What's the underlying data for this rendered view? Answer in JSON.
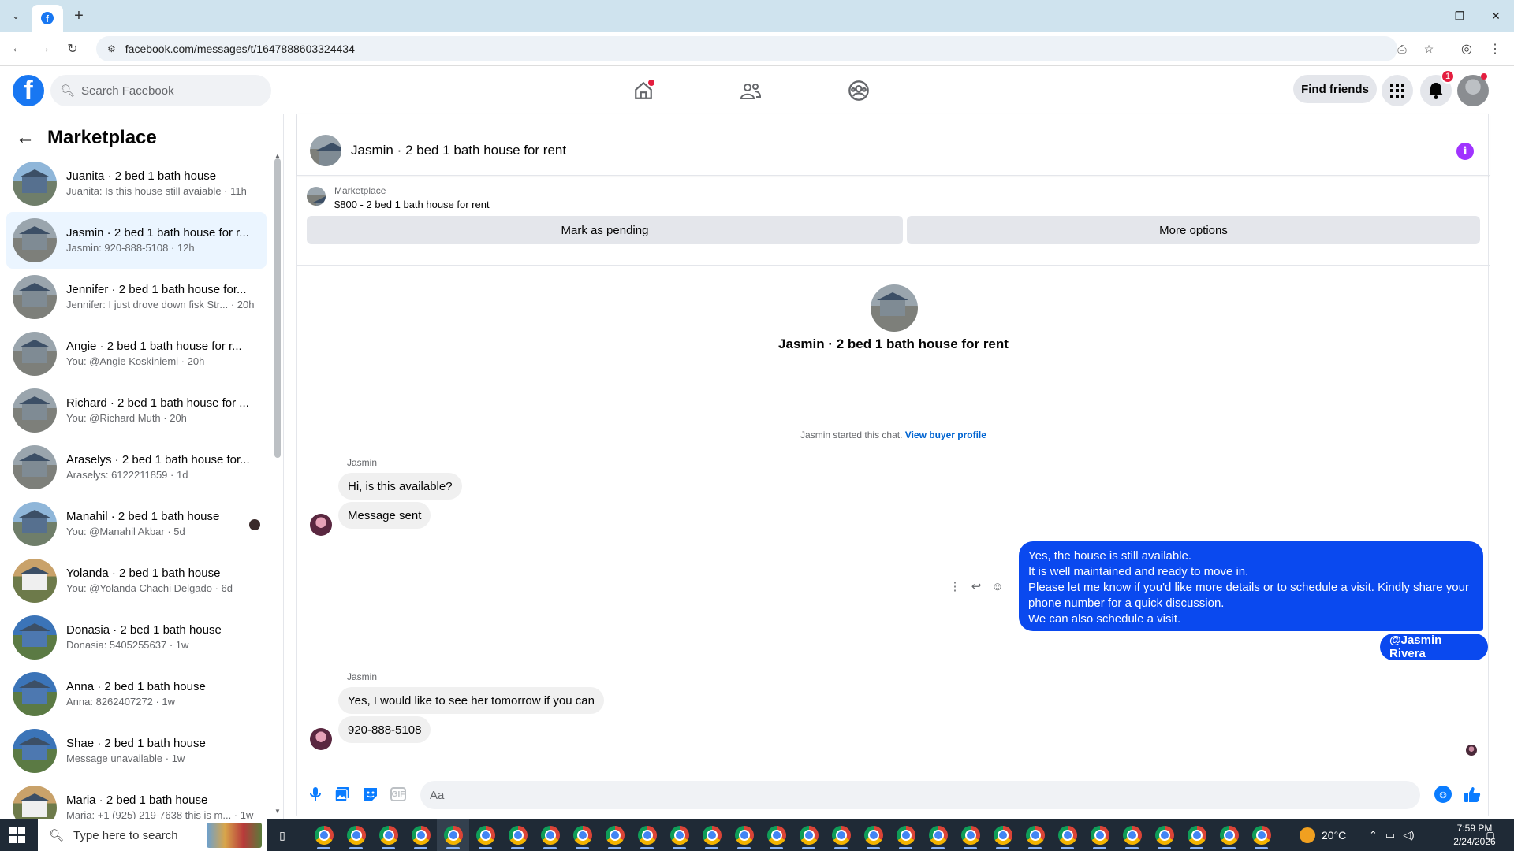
{
  "browser": {
    "url": "facebook.com/messages/t/1647888603324434"
  },
  "header": {
    "search_placeholder": "Search Facebook",
    "find_friends": "Find friends",
    "notifications_count": "1"
  },
  "sidebar": {
    "title": "Marketplace",
    "conversations": [
      {
        "title": "Juanita · 2 bed 1 bath house",
        "subtitle": "Juanita: Is this house still avaiable · 11h",
        "thumb": "blue"
      },
      {
        "title": "Jasmin · 2 bed 1 bath house for r...",
        "subtitle": "Jasmin: 920-888-5108 · 12h",
        "thumb": "grey",
        "active": true
      },
      {
        "title": "Jennifer · 2 bed 1 bath house for...",
        "subtitle": "Jennifer: I just drove down fisk Str... · 20h",
        "thumb": "grey"
      },
      {
        "title": "Angie · 2 bed 1 bath house for r...",
        "subtitle": "You: @Angie Koskiniemi · 20h",
        "thumb": "grey"
      },
      {
        "title": "Richard · 2 bed 1 bath house for ...",
        "subtitle": "You: @Richard Muth · 20h",
        "thumb": "grey"
      },
      {
        "title": "Araselys · 2 bed 1 bath house for...",
        "subtitle": "Araselys: 6122211859 · 1d",
        "thumb": "grey"
      },
      {
        "title": "Manahil · 2 bed 1 bath house",
        "subtitle": "You: @Manahil Akbar · 5d",
        "thumb": "blue",
        "seen": true
      },
      {
        "title": "Yolanda · 2 bed 1 bath house",
        "subtitle": "You: @Yolanda Chachi Delgado · 6d",
        "thumb": "white"
      },
      {
        "title": "Donasia · 2 bed 1 bath house",
        "subtitle": "Donasia: 5405255637 · 1w",
        "thumb": "blue2"
      },
      {
        "title": "Anna · 2 bed 1 bath house",
        "subtitle": "Anna: 8262407272 · 1w",
        "thumb": "blue2"
      },
      {
        "title": "Shae · 2 bed 1 bath house",
        "subtitle": "Message unavailable · 1w",
        "thumb": "blue2"
      },
      {
        "title": "Maria · 2 bed 1 bath house",
        "subtitle": "Maria: +1 (925) 219-7638 this is m... · 1w",
        "thumb": "white"
      }
    ]
  },
  "chat": {
    "title": "Jasmin · 2 bed 1 bath house for rent",
    "listing_label": "Marketplace",
    "listing_title": "$800 - 2 bed 1 bath house for rent",
    "mark_pending": "Mark as pending",
    "more_options": "More options",
    "intro_title": "Jasmin · 2 bed 1 bath house for rent",
    "started_text": "Jasmin started this chat.",
    "view_profile": "View buyer profile",
    "sender1": "Jasmin",
    "msg1": "Hi, is this available?",
    "msg2": "Message sent",
    "out_lines": [
      "Yes, the house is still available.",
      "It is well maintained and ready to move in.",
      "Please let me know if you'd like more details or to schedule a visit. Kindly share your",
      "phone number for a quick discussion.",
      "We can also schedule a visit."
    ],
    "mention": "@Jasmin Rivera",
    "sender2": "Jasmin",
    "msg3": "Yes, I would like to see her tomorrow if you can",
    "msg4": "920-888-5108",
    "composer_placeholder": "Aa"
  },
  "taskbar": {
    "search_placeholder": "Type here to search",
    "temperature": "20°C",
    "time": "7:59 PM",
    "date": "2/24/2026"
  }
}
